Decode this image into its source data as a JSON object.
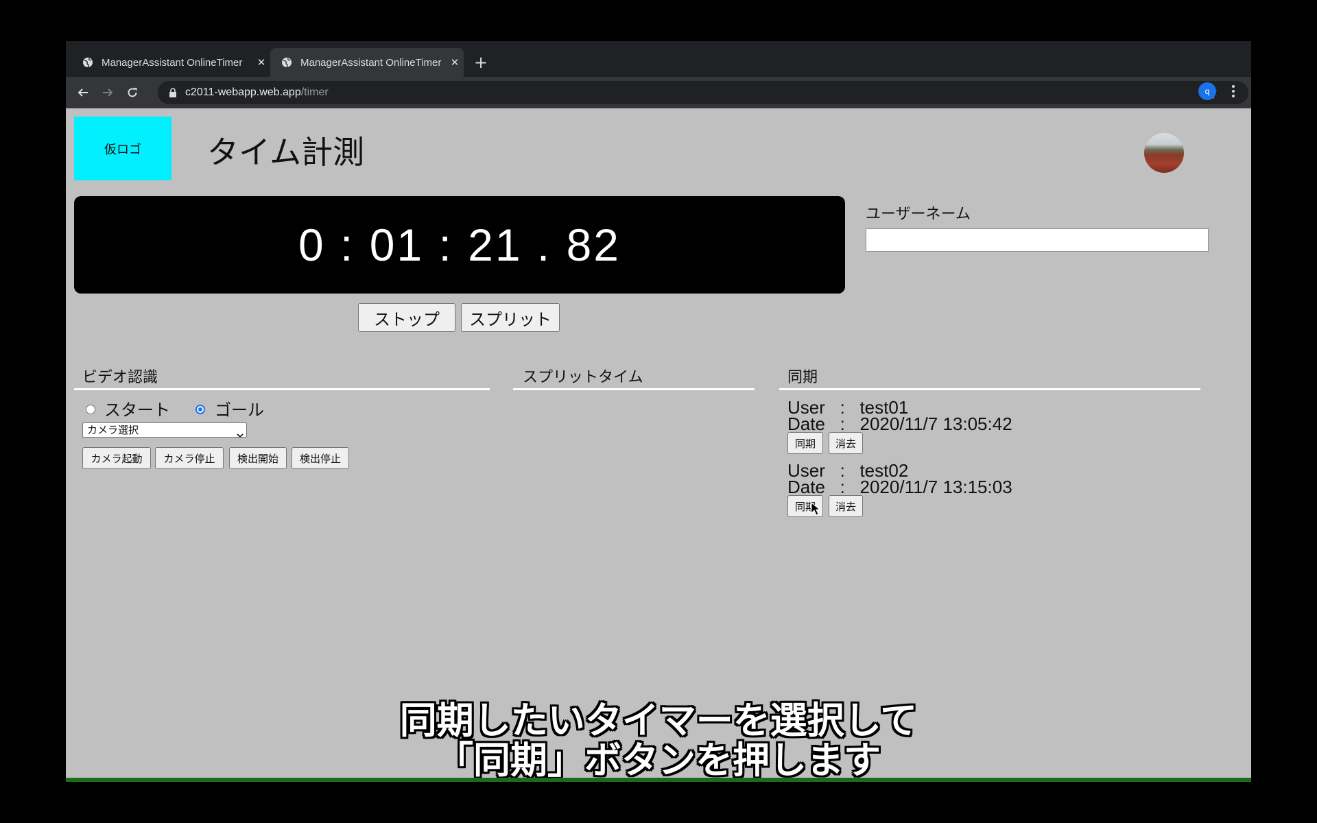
{
  "browser": {
    "tabs": [
      {
        "title": "ManagerAssistant OnlineTimer",
        "close": "✕"
      },
      {
        "title": "ManagerAssistant OnlineTimer",
        "close": "✕"
      }
    ],
    "new_tab": "+",
    "url_host": "c2011-webapp.web.app",
    "url_path": "/timer",
    "profile_initial": "q"
  },
  "header": {
    "logo_text": "仮ロゴ",
    "title": "タイム計測"
  },
  "timer": {
    "display": "0 : 01 : 21 . 82",
    "stop_label": "ストップ",
    "split_label": "スプリット"
  },
  "user": {
    "label": "ユーザーネーム",
    "value": ""
  },
  "video": {
    "title": "ビデオ認識",
    "radio_start": "スタート",
    "radio_goal": "ゴール",
    "camera_select": "カメラ選択",
    "camera_start": "カメラ起動",
    "camera_stop": "カメラ停止",
    "detect_start": "検出開始",
    "detect_stop": "検出停止"
  },
  "split": {
    "title": "スプリットタイム"
  },
  "sync": {
    "title": "同期",
    "entries": [
      {
        "user_line": "User   :   test01",
        "date_line": "Date   :   2020/11/7 13:05:42",
        "sync_label": "同期",
        "delete_label": "消去"
      },
      {
        "user_line": "User   :   test02",
        "date_line": "Date   :   2020/11/7 13:15:03",
        "sync_label": "同期",
        "delete_label": "消去"
      }
    ]
  },
  "caption": {
    "line1": "同期したいタイマーを選択して",
    "line2": "「同期」ボタンを押します"
  },
  "colors": {
    "logo_bg": "#00f0ff",
    "page_bg": "#c0c0c0",
    "timer_bg": "#000000",
    "accent": "#1a73e8"
  }
}
